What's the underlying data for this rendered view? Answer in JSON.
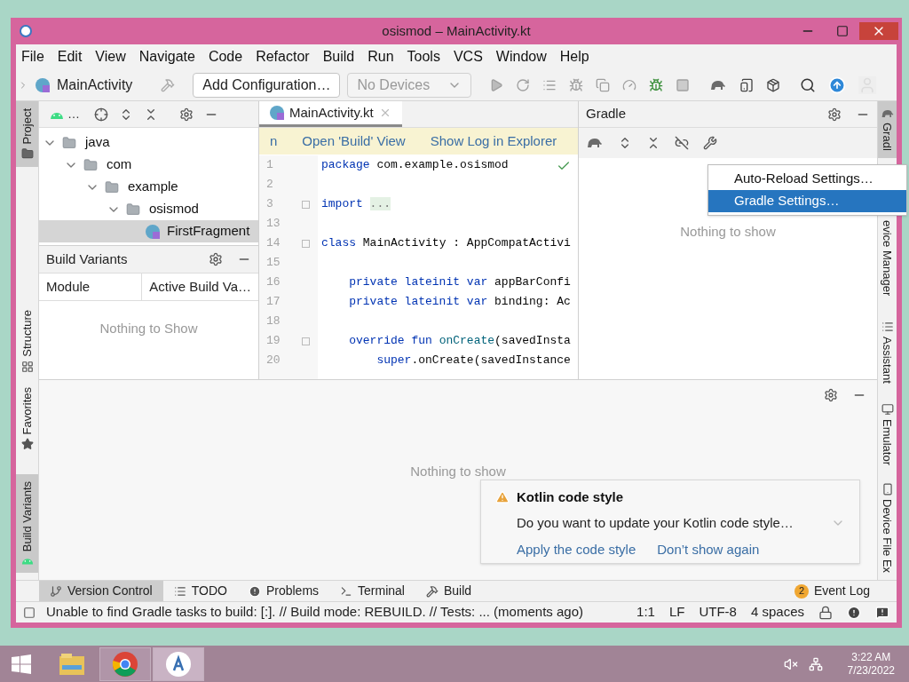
{
  "window": {
    "title": "osismod – MainActivity.kt"
  },
  "menu": [
    "File",
    "Edit",
    "View",
    "Navigate",
    "Code",
    "Refactor",
    "Build",
    "Run",
    "Tools",
    "VCS",
    "Window",
    "Help"
  ],
  "toolbar": {
    "breadcrumb": "MainActivity",
    "config_button": "Add Configuration…",
    "device_selector": {
      "label": "No Devices",
      "disabled": true
    }
  },
  "left_stripe": {
    "top": [
      {
        "label": "Project",
        "selected": true
      },
      {
        "label": "Structure",
        "selected": false
      }
    ],
    "bottom": [
      {
        "label": "Favorites",
        "selected": false
      },
      {
        "label": "Build Variants",
        "selected": true
      }
    ]
  },
  "project_panel": {
    "view_selector": "…",
    "tree": [
      {
        "label": "java",
        "kind": "folder",
        "expanded": true,
        "selected": false,
        "children": [
          {
            "label": "com",
            "kind": "folder",
            "expanded": true,
            "selected": false,
            "children": [
              {
                "label": "example",
                "kind": "folder",
                "expanded": true,
                "selected": false,
                "children": [
                  {
                    "label": "osismod",
                    "kind": "folder",
                    "expanded": true,
                    "selected": false,
                    "children": [
                      {
                        "label": "FirstFragment",
                        "kind": "class",
                        "expanded": false,
                        "selected": true
                      }
                    ]
                  }
                ]
              }
            ]
          }
        ]
      }
    ]
  },
  "build_variants": {
    "title": "Build Variants",
    "columns": [
      "Module",
      "Active Build Va…"
    ],
    "empty_text": "Nothing to Show"
  },
  "editor": {
    "tab": {
      "label": "MainActivity.kt",
      "selected": true
    },
    "banner": {
      "fragment": "n",
      "links": [
        "Open 'Build' View",
        "Show Log in Explorer"
      ]
    },
    "lines": [
      {
        "number": "1",
        "foldable": false,
        "tokens": [
          {
            "text": "package",
            "kind": "keyword"
          },
          {
            "text": " com.example.osismod",
            "kind": "plain"
          }
        ]
      },
      {
        "number": "2",
        "foldable": false
      },
      {
        "number": "3",
        "foldable": true,
        "tokens": [
          {
            "text": "import ",
            "kind": "keyword"
          },
          {
            "text": "...",
            "kind": "folded"
          }
        ]
      },
      {
        "number": "13",
        "foldable": false
      },
      {
        "number": "14",
        "foldable": true,
        "tokens": [
          {
            "text": "class",
            "kind": "keyword"
          },
          {
            "text": " MainActivity : AppCompatActivi",
            "kind": "plain"
          }
        ]
      },
      {
        "number": "15",
        "foldable": false
      },
      {
        "number": "16",
        "foldable": false,
        "tokens": [
          {
            "text": "    private lateinit var",
            "kind": "keyword"
          },
          {
            "text": " appBarConfi",
            "kind": "plain"
          }
        ]
      },
      {
        "number": "17",
        "foldable": false,
        "tokens": [
          {
            "text": "    private lateinit var",
            "kind": "keyword"
          },
          {
            "text": " binding: Ac",
            "kind": "plain"
          }
        ]
      },
      {
        "number": "18",
        "foldable": false
      },
      {
        "number": "19",
        "foldable": true,
        "tokens": [
          {
            "text": "    override fun ",
            "kind": "keyword"
          },
          {
            "text": "onCreate",
            "kind": "call"
          },
          {
            "text": "(savedInsta",
            "kind": "plain"
          }
        ]
      },
      {
        "number": "20",
        "foldable": false,
        "tokens": [
          {
            "text": "        super",
            "kind": "keyword"
          },
          {
            "text": ".onCreate(savedInstance",
            "kind": "plain"
          }
        ]
      }
    ]
  },
  "gradle": {
    "title": "Gradle",
    "empty_text": "Nothing to show",
    "menu": [
      {
        "label": "Auto-Reload Settings…",
        "selected": false
      },
      {
        "label": "Gradle Settings…",
        "selected": true
      }
    ]
  },
  "right_stripe": {
    "top": [
      {
        "label": "Gradl",
        "selected": true
      },
      {
        "label": "evice Manager",
        "selected": false
      },
      {
        "label": "Assistant",
        "selected": false
      }
    ],
    "bottom": [
      {
        "label": "Emulator",
        "selected": false
      },
      {
        "label": "Device File Ex",
        "selected": false
      }
    ]
  },
  "bottom_panel": {
    "empty_text": "Nothing to show"
  },
  "notification": {
    "title": "Kotlin code style",
    "message": "Do you want to update your Kotlin code style…",
    "actions": [
      "Apply the code style",
      "Don’t show again"
    ]
  },
  "tool_tabs": [
    {
      "label": "Version Control",
      "selected": true
    },
    {
      "label": "TODO",
      "selected": false
    },
    {
      "label": "Problems",
      "selected": false
    },
    {
      "label": "Terminal",
      "selected": false
    },
    {
      "label": "Build",
      "selected": false
    }
  ],
  "event_log": {
    "count": "2",
    "label": "Event Log"
  },
  "status_bar": {
    "message": "Unable to find Gradle tasks to build: [:]. // Build mode: REBUILD. // Tests: ... (moments ago)",
    "items": [
      "1:1",
      "LF",
      "UTF-8",
      "4 spaces"
    ]
  },
  "taskbar": {
    "apps": [
      {
        "kind": "explorer",
        "selected": false
      },
      {
        "kind": "chrome",
        "selected": false
      },
      {
        "kind": "studio",
        "selected": true
      }
    ]
  },
  "clock": {
    "time": "3:22 AM",
    "date": "7/23/2022"
  }
}
